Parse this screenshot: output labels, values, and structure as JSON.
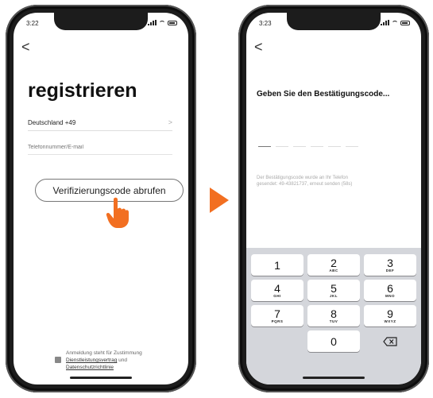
{
  "left_screen": {
    "status": {
      "time": "3:22"
    },
    "back_label": "<",
    "title": "registrieren",
    "country": {
      "value": "Deutschland +49",
      "chevron": ">"
    },
    "phone_field": {
      "placeholder": "Telefonnummer/E-mail"
    },
    "verify_button": "Verifizierungscode abrufen",
    "pointer_icon": "pointing-hand-icon",
    "agreement": {
      "line1": "Anmeldung steht für Zustimmung",
      "link1": "Dienstleistungsvertrag",
      "und": "und",
      "link2": "Datenschutzrichtlinie"
    }
  },
  "arrow_icon": "right-arrow-icon",
  "right_screen": {
    "status": {
      "time": "3:23"
    },
    "back_label": "<",
    "title": "Geben Sie den Bestätigungscode...",
    "info_line1": "Der Bestätigungscode wurde an Ihr Telefon",
    "info_line2": "gesendet: 49-43821737, erneut senden (58s)",
    "keypad": [
      {
        "digit": "1",
        "letters": ""
      },
      {
        "digit": "2",
        "letters": "ABC"
      },
      {
        "digit": "3",
        "letters": "DEF"
      },
      {
        "digit": "4",
        "letters": "GHI"
      },
      {
        "digit": "5",
        "letters": "JKL"
      },
      {
        "digit": "6",
        "letters": "MNO"
      },
      {
        "digit": "7",
        "letters": "PQRS"
      },
      {
        "digit": "8",
        "letters": "TUV"
      },
      {
        "digit": "9",
        "letters": "WXYZ"
      },
      {
        "digit": "0",
        "letters": ""
      }
    ],
    "delete_icon": "backspace-icon"
  },
  "colors": {
    "accent": "#f26f21",
    "keypad_bg": "#d4d6db"
  }
}
